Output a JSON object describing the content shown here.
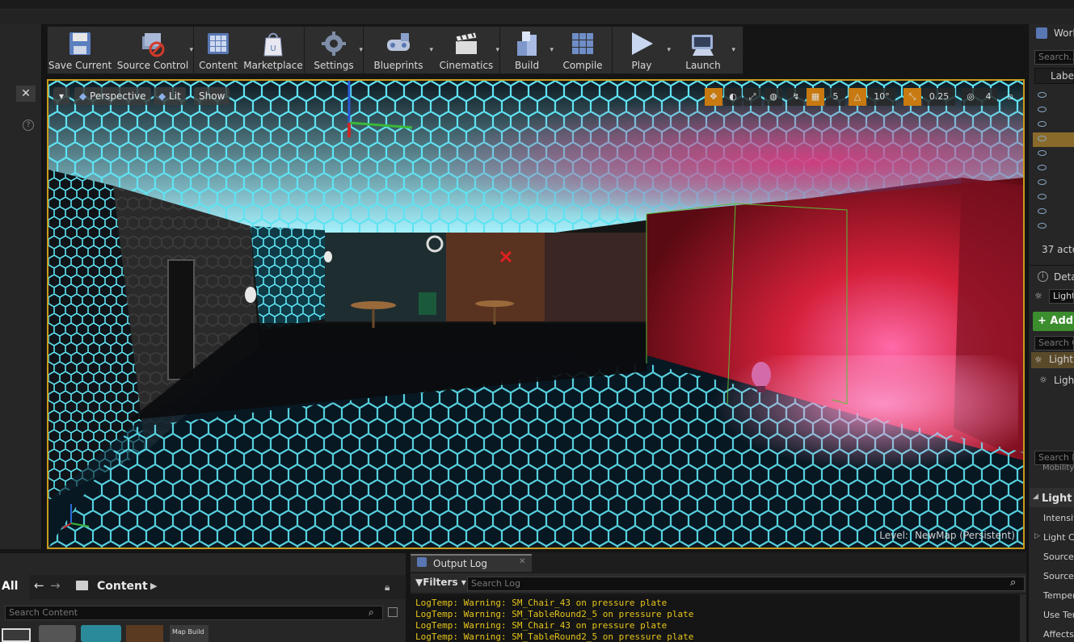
{
  "toolbar": {
    "buttons": [
      {
        "label": "Save Current",
        "icon": "save-icon"
      },
      {
        "label": "Source Control",
        "icon": "source-control-icon"
      },
      {
        "label": "Content",
        "icon": "content-icon"
      },
      {
        "label": "Marketplace",
        "icon": "marketplace-icon"
      },
      {
        "label": "Settings",
        "icon": "settings-icon"
      },
      {
        "label": "Blueprints",
        "icon": "blueprints-icon"
      },
      {
        "label": "Cinematics",
        "icon": "cinematics-icon"
      },
      {
        "label": "Build",
        "icon": "build-icon"
      },
      {
        "label": "Compile",
        "icon": "compile-icon"
      },
      {
        "label": "Play",
        "icon": "play-icon"
      },
      {
        "label": "Launch",
        "icon": "launch-icon"
      }
    ]
  },
  "viewport": {
    "perspective_label": "Perspective",
    "lit_label": "Lit",
    "show_label": "Show",
    "grid_snap": "5",
    "rotation_snap": "10°",
    "scale_snap": "0.25",
    "camera_speed": "4",
    "level_label": "Level:",
    "level_name": "NewMap (Persistent)"
  },
  "world_outliner": {
    "title": "Worl",
    "search_placeholder": "Search...",
    "column_label": "Labe",
    "actor_count": "37 acto"
  },
  "details": {
    "title": "Deta",
    "selected_name": "Light",
    "add_label": "+ Add",
    "search_components_placeholder": "Search C",
    "component_1": "Light",
    "component_2": "Ligh",
    "search_details_placeholder": "Search D",
    "mobility_label": "Mobility",
    "section_light": "Light",
    "props": [
      "Intensit",
      "Light Co",
      "Source",
      "Source",
      "Temper",
      "Use Ter",
      "Affects"
    ]
  },
  "content_browser": {
    "all_label": "All",
    "path_label": "Content",
    "search_placeholder": "Search Content",
    "thumb_label": "Map Build"
  },
  "output_log": {
    "tab_label": "Output Log",
    "filters_label": "Filters",
    "search_placeholder": "Search Log",
    "lines": [
      "LogTemp: Warning: SM_Chair_43 on pressure plate",
      "LogTemp: Warning: SM_TableRound2_5 on pressure plate",
      "LogTemp: Warning: SM_Chair_43 on pressure plate",
      "LogTemp: Warning: SM_TableRound2_5 on pressure plate"
    ]
  },
  "colors": {
    "accent": "#c99a1c",
    "log_warning": "#e6c51a",
    "add_button": "#3b8d2e"
  }
}
